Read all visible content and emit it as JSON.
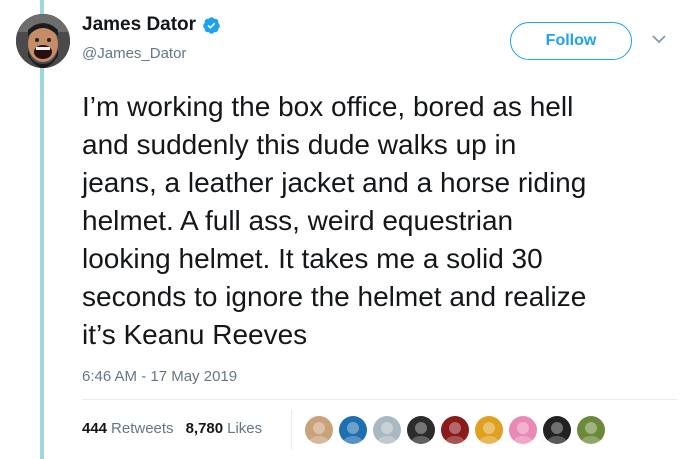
{
  "user": {
    "display_name": "James Dator",
    "handle": "@James_Dator"
  },
  "follow_label": "Follow",
  "tweet": {
    "lines": [
      "I’m working the box office, bored as hell",
      "and suddenly this dude walks up in",
      "jeans, a leather jacket and a horse riding",
      "helmet. A full ass, weird equestrian",
      "looking helmet. It takes me a solid 30",
      "seconds to ignore the helmet and realize",
      "it’s Keanu Reeves"
    ],
    "timestamp": "6:46 AM - 17 May 2019"
  },
  "stats": {
    "retweets_count": "444",
    "retweets_label": "Retweets",
    "likes_count": "8,780",
    "likes_label": "Likes"
  },
  "colors": {
    "accent": "#1da1f2",
    "thread_line": "#9ad7de",
    "secondary_text": "#657786"
  },
  "liker_avatars": [
    {
      "color": "#c9a27a"
    },
    {
      "color": "#1e6fb0"
    },
    {
      "color": "#aab8c2"
    },
    {
      "color": "#2b2b2b"
    },
    {
      "color": "#8b1a1a"
    },
    {
      "color": "#e0a020"
    },
    {
      "color": "#e88ab5"
    },
    {
      "color": "#222222"
    },
    {
      "color": "#6a8a3a"
    }
  ]
}
